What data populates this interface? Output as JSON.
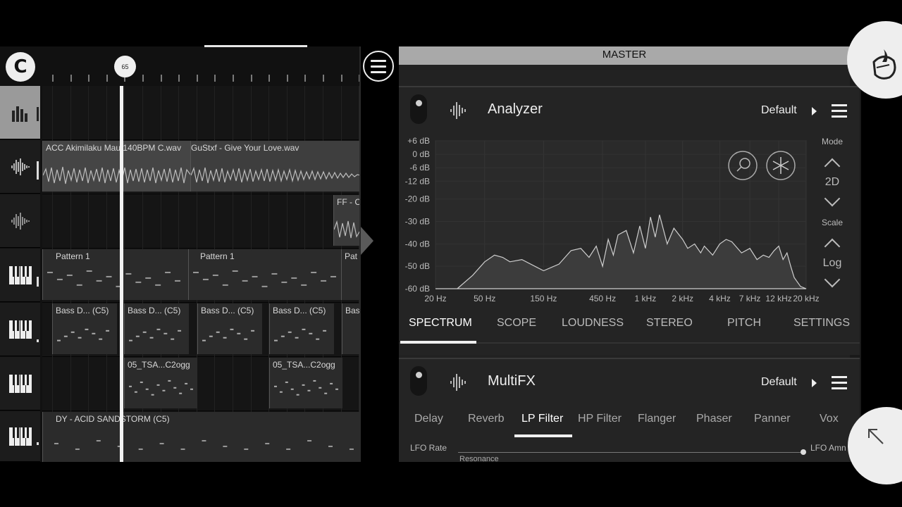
{
  "playlist": {
    "logo_glyph": "C",
    "position_marker": "65",
    "clips": [
      {
        "label": "ACC Akimilaku Mau 140BPM C.wav",
        "kind": "audio"
      },
      {
        "label": "GuStxf - Give Your Love.wav",
        "kind": "audio"
      },
      {
        "label": "FF - C",
        "kind": "audio"
      },
      {
        "label": "Pattern 1",
        "kind": "pattern"
      },
      {
        "label": "Pattern 1",
        "kind": "pattern"
      },
      {
        "label": "Pat",
        "kind": "pattern"
      },
      {
        "label": "Bass D... (C5)",
        "kind": "pattern"
      },
      {
        "label": "Bass D... (C5)",
        "kind": "pattern"
      },
      {
        "label": "Bass D... (C5)",
        "kind": "pattern"
      },
      {
        "label": "Bass D... (C5)",
        "kind": "pattern"
      },
      {
        "label": "Bas",
        "kind": "pattern"
      },
      {
        "label": "05_TSA...C2ogg",
        "kind": "pattern"
      },
      {
        "label": "05_TSA...C2ogg",
        "kind": "pattern"
      },
      {
        "label": "DY - ACID SANDSTORM (C5)",
        "kind": "pattern"
      }
    ],
    "track_icons": [
      "mixer-bars-icon",
      "audio-wave-icon",
      "audio-wave-icon",
      "piano-icon",
      "piano-icon",
      "piano-icon",
      "piano-icon"
    ]
  },
  "mixer": {
    "title": "MASTER",
    "analyzer": {
      "name": "Analyzer",
      "preset": "Default",
      "y_ticks": [
        "+6 dB",
        "0 dB",
        "-6 dB",
        "-12 dB",
        "-20 dB",
        "-30 dB",
        "-40 dB",
        "-50 dB",
        "-60 dB"
      ],
      "x_ticks": [
        "20 Hz",
        "50 Hz",
        "150 Hz",
        "450 Hz",
        "1 kHz",
        "2 kHz",
        "4 kHz",
        "7 kHz",
        "12 kHz",
        "20 kHz"
      ],
      "mode_label": "Mode",
      "mode_value": "2D",
      "scale_label": "Scale",
      "scale_value": "Log",
      "tabs": [
        "SPECTRUM",
        "SCOPE",
        "LOUDNESS",
        "STEREO",
        "PITCH",
        "SETTINGS"
      ],
      "active_tab": "SPECTRUM"
    },
    "multifx": {
      "name": "MultiFX",
      "preset": "Default",
      "tabs": [
        "Delay",
        "Reverb",
        "LP Filter",
        "HP Filter",
        "Flanger",
        "Phaser",
        "Panner",
        "Vox"
      ],
      "active_tab": "LP Filter",
      "lfo_rate_label": "LFO Rate",
      "lfo_amount_label": "LFO Amn",
      "resonance_label": "Resonance"
    }
  },
  "chart_data": {
    "type": "area",
    "title": "",
    "xlabel": "",
    "ylabel": "",
    "x_scale": "log",
    "xlim": [
      20,
      20000
    ],
    "ylim": [
      -60,
      6
    ],
    "x": [
      20,
      30,
      40,
      50,
      60,
      70,
      80,
      100,
      150,
      200,
      250,
      300,
      350,
      400,
      450,
      500,
      550,
      600,
      700,
      800,
      900,
      1000,
      1100,
      1200,
      1300,
      1500,
      1700,
      2000,
      2200,
      2500,
      2800,
      3000,
      3500,
      4000,
      4500,
      5000,
      6000,
      7000,
      8000,
      9000,
      10000,
      11000,
      12000,
      13000,
      14000,
      15000,
      16000,
      18000,
      20000
    ],
    "y": [
      -60,
      -60,
      -54,
      -48,
      -45,
      -46,
      -48,
      -47,
      -52,
      -49,
      -43,
      -42,
      -46,
      -41,
      -50,
      -38,
      -45,
      -36,
      -34,
      -44,
      -32,
      -42,
      -28,
      -37,
      -27,
      -40,
      -33,
      -38,
      -42,
      -40,
      -44,
      -41,
      -45,
      -40,
      -38,
      -39,
      -44,
      -42,
      -47,
      -45,
      -46,
      -43,
      -41,
      -47,
      -44,
      -50,
      -55,
      -59,
      -60
    ],
    "grid": true,
    "legend": "none"
  }
}
